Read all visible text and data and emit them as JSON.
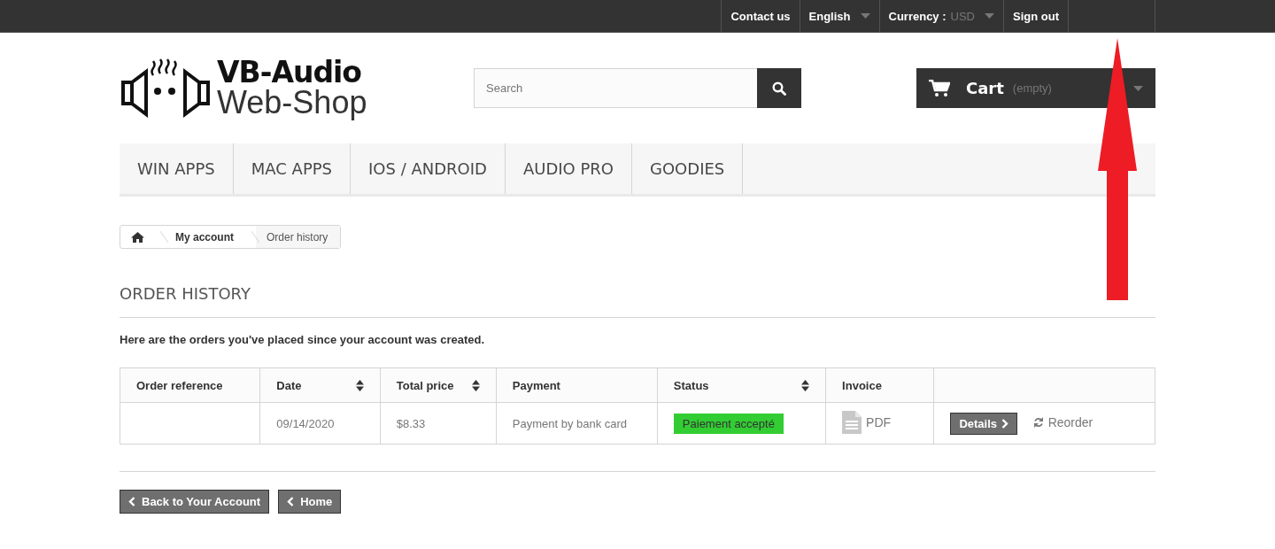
{
  "top_bar": {
    "links": [
      {
        "label": "Contact us",
        "kind": "link"
      },
      {
        "label": "English",
        "kind": "dropdown"
      },
      {
        "label": "Currency :",
        "value": "USD",
        "kind": "dropdown"
      },
      {
        "label": "Sign out",
        "kind": "link"
      }
    ]
  },
  "logo": {
    "line1": "VB-Audio",
    "line2": "Web-Shop"
  },
  "search": {
    "placeholder": "Search"
  },
  "cart": {
    "label": "Cart",
    "status": "(empty)"
  },
  "menu": [
    "WIN APPS",
    "MAC APPS",
    "IOS / ANDROID",
    "AUDIO PRO",
    "GOODIES"
  ],
  "breadcrumb": [
    "My account",
    "Order history"
  ],
  "page_title": "ORDER HISTORY",
  "intro": "Here are the orders you've placed since your account was created.",
  "table": {
    "columns": [
      {
        "label": "Order reference",
        "sortable": false
      },
      {
        "label": "Date",
        "sortable": true
      },
      {
        "label": "Total price",
        "sortable": true
      },
      {
        "label": "Payment",
        "sortable": false
      },
      {
        "label": "Status",
        "sortable": true
      },
      {
        "label": "Invoice",
        "sortable": false
      },
      {
        "sortable": false
      }
    ],
    "rows": [
      {
        "date": "09/14/2020",
        "total": "$8.33",
        "payment": "Payment by bank card",
        "status": "Paiement accepté",
        "invoice": "PDF",
        "details": "Details",
        "reorder": "Reorder"
      }
    ]
  },
  "footer_buttons": [
    "Back to Your Account",
    "Home"
  ]
}
